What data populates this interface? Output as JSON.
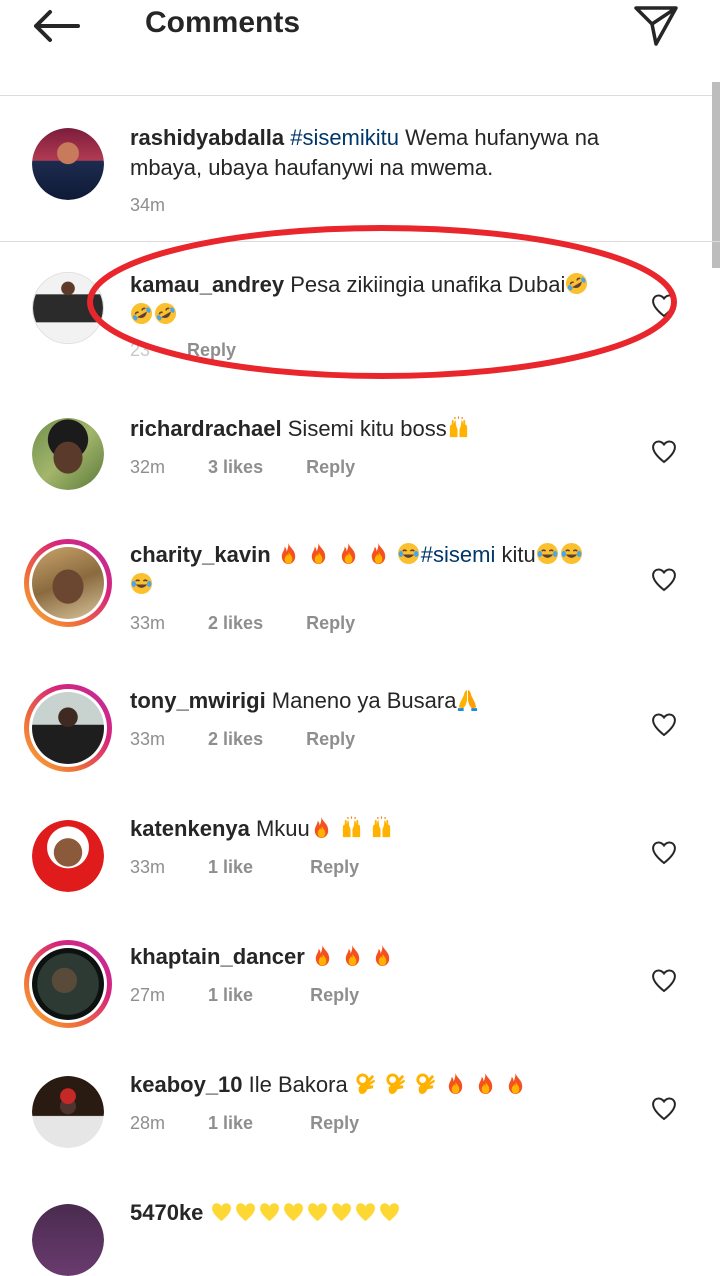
{
  "header": {
    "title": "Comments"
  },
  "caption": {
    "username": "rashidyabdalla",
    "hashtag": "#sisemikitu",
    "text": " Wema hufanywa na mbaya, ubaya haufanywi na mwema.",
    "time": "34m"
  },
  "comments": [
    {
      "username": "kamau_andrey",
      "text": " Pesa zikiingia unafika Dubai",
      "emoji": [
        "rofl-icon",
        "rofl-icon",
        "rofl-icon"
      ],
      "time": "23",
      "likes": "",
      "reply": "Reply"
    },
    {
      "username": "richardrachael",
      "text": " Sisemi kitu boss",
      "emoji": [
        "raising-hands-icon"
      ],
      "time": "32m",
      "likes": "3 likes",
      "reply": "Reply"
    },
    {
      "username": "charity_kavin",
      "text_before": " ",
      "hashtag": "#sisemi",
      "text_after": " kitu",
      "emoji": [
        "fire-icon",
        "fire-icon",
        "fire-icon",
        "fire-icon",
        "joy-icon",
        "joy-icon",
        "joy-icon",
        "joy-icon"
      ],
      "time": "33m",
      "likes": "2 likes",
      "reply": "Reply"
    },
    {
      "username": "tony_mwirigi",
      "text": " Maneno ya Busara",
      "emoji": [
        "folded-hands-icon"
      ],
      "time": "33m",
      "likes": "2 likes",
      "reply": "Reply"
    },
    {
      "username": "katenkenya",
      "text": " Mkuu",
      "emoji": [
        "fire-icon",
        "raising-hands-icon",
        "raising-hands-icon"
      ],
      "time": "33m",
      "likes": "1 like",
      "reply": "Reply"
    },
    {
      "username": "khaptain_dancer",
      "text": " ",
      "emoji": [
        "fire-icon",
        "fire-icon",
        "fire-icon"
      ],
      "time": "27m",
      "likes": "1 like",
      "reply": "Reply"
    },
    {
      "username": "keaboy_10",
      "text": " Ile Bakora ",
      "emoji": [
        "ok-hand-icon",
        "ok-hand-icon",
        "ok-hand-icon",
        "fire-icon",
        "fire-icon",
        "fire-icon"
      ],
      "time": "28m",
      "likes": "1 like",
      "reply": "Reply"
    },
    {
      "username": "5470ke",
      "text": " ",
      "emoji": [
        "yellow-heart-icon",
        "yellow-heart-icon",
        "yellow-heart-icon",
        "yellow-heart-icon",
        "yellow-heart-icon",
        "yellow-heart-icon",
        "yellow-heart-icon",
        "yellow-heart-icon"
      ],
      "time": "",
      "likes": "",
      "reply": ""
    }
  ],
  "colors": {
    "annotation_oval": "#e8262c",
    "hashtag": "#00376b",
    "meta_gray": "#8e8e8e",
    "divider": "#dbdbdb"
  }
}
